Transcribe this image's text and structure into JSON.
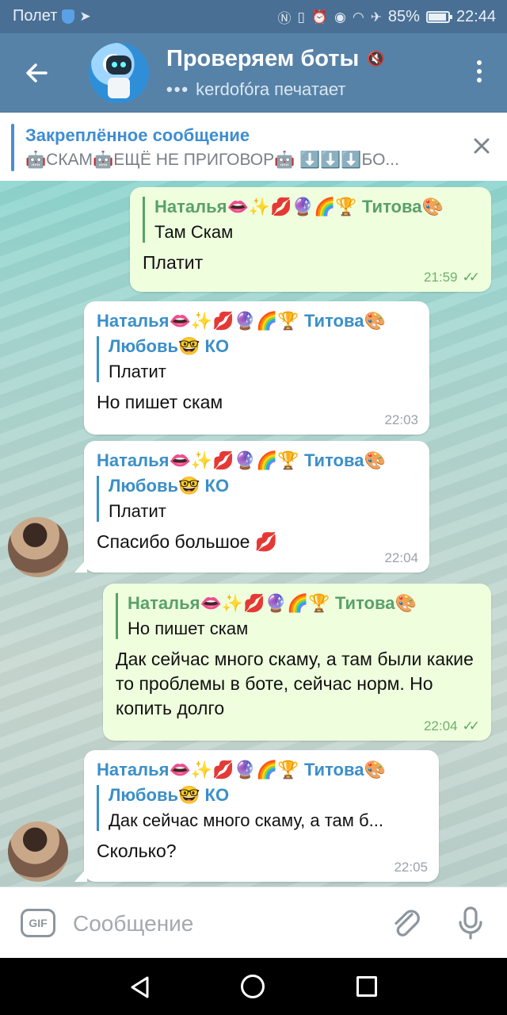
{
  "status_bar": {
    "carrier": "Полет",
    "battery": "85%",
    "time": "22:44"
  },
  "header": {
    "title": "Проверяем боты",
    "typing_dots": "•••",
    "subtitle": "kerdofóra печатает"
  },
  "pinned": {
    "title": "Закреплённое сообщение",
    "text": "🤖СКАМ🤖ЕЩЁ НЕ ПРИГОВОР🤖 ⬇️⬇️⬇️БО..."
  },
  "messages": [
    {
      "direction": "out",
      "reply_name": "Наталья👄✨💋🔮🌈🏆 Титова🎨",
      "reply_text": "Там Скам",
      "text": "Платит",
      "time": "21:59",
      "read": true
    },
    {
      "direction": "in",
      "sender": "Наталья👄✨💋🔮🌈🏆 Титова🎨",
      "reply_name": "Любовь🤓 КО",
      "reply_text": "Платит",
      "text": "Но пишет скам",
      "time": "22:03"
    },
    {
      "direction": "in",
      "sender": "Наталья👄✨💋🔮🌈🏆 Титова🎨",
      "reply_name": "Любовь🤓 КО",
      "reply_text": "Платит",
      "text": "Спасибо большое 💋",
      "time": "22:04"
    },
    {
      "direction": "out",
      "reply_name": "Наталья👄✨💋🔮🌈🏆 Титова🎨",
      "reply_text": "Но пишет скам",
      "text": "Дак сейчас много скаму, а там были какие то проблемы в боте, сейчас норм. Но копить долго",
      "time": "22:04",
      "read": true
    },
    {
      "direction": "in",
      "sender": "Наталья👄✨💋🔮🌈🏆 Титова🎨",
      "reply_name": "Любовь🤓 КО",
      "reply_text": "Дак сейчас много скаму, а там б...",
      "text": "Сколько?",
      "time": "22:05"
    }
  ],
  "input": {
    "gif_label": "GIF",
    "placeholder": "Сообщение"
  },
  "colors": {
    "header": "#5682a8",
    "statusbar": "#4a6f94",
    "out_bubble": "#efffde",
    "in_bubble": "#ffffff",
    "accent": "#3b8fc8"
  }
}
